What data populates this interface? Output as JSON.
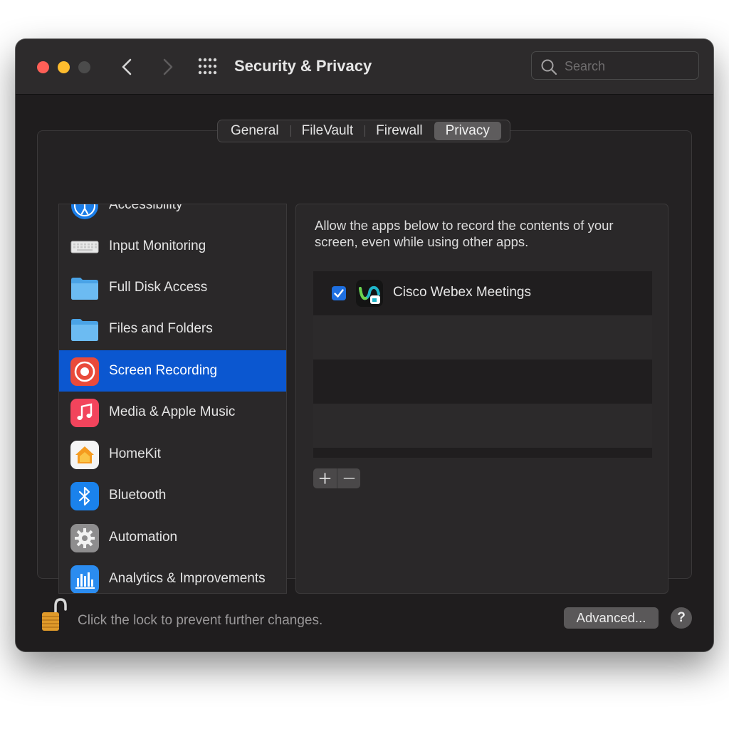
{
  "window": {
    "title": "Security & Privacy"
  },
  "search": {
    "placeholder": "Search",
    "value": ""
  },
  "tabs": [
    {
      "label": "General",
      "active": false
    },
    {
      "label": "FileVault",
      "active": false
    },
    {
      "label": "Firewall",
      "active": false
    },
    {
      "label": "Privacy",
      "active": true
    }
  ],
  "sidebar": {
    "items": [
      {
        "label": "Accessibility",
        "icon": "accessibility-icon"
      },
      {
        "label": "Input Monitoring",
        "icon": "keyboard-icon"
      },
      {
        "label": "Full Disk Access",
        "icon": "folder-icon"
      },
      {
        "label": "Files and Folders",
        "icon": "folder-icon"
      },
      {
        "label": "Screen Recording",
        "icon": "screen-recording-icon",
        "selected": true
      },
      {
        "label": "Media & Apple Music",
        "icon": "music-icon"
      },
      {
        "label": "HomeKit",
        "icon": "home-icon"
      },
      {
        "label": "Bluetooth",
        "icon": "bluetooth-icon"
      },
      {
        "label": "Automation",
        "icon": "gear-icon"
      },
      {
        "label": "Analytics & Improvements",
        "icon": "analytics-icon"
      }
    ]
  },
  "main": {
    "description": "Allow the apps below to record the contents of your screen, even while using other apps.",
    "apps": [
      {
        "name": "Cisco Webex Meetings",
        "checked": true,
        "icon": "webex-icon"
      }
    ],
    "add_label": "+",
    "remove_label": "−"
  },
  "footer": {
    "lock_text": "Click the lock to prevent further changes.",
    "advanced_label": "Advanced...",
    "help_label": "?"
  },
  "colors": {
    "accent": "#0b57d0",
    "close": "#fe5f57",
    "minimize": "#febc2e"
  }
}
